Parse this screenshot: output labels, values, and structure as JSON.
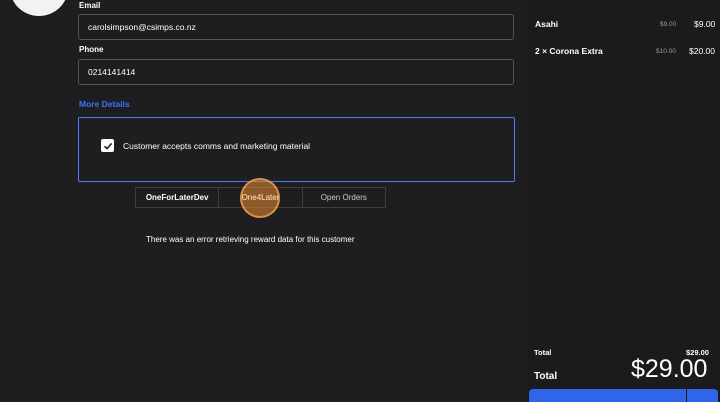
{
  "customer": {
    "email_label": "Email",
    "email_value": "carolsimpson@csimps.co.nz",
    "phone_label": "Phone",
    "phone_value": "0214141414",
    "more_details": "More Details",
    "comms_label": "Customer accepts comms and marketing material",
    "comms_checked": true
  },
  "tabs": [
    "OneForLaterDev",
    "One4Later",
    "Open Orders"
  ],
  "error_message": "There was an error retrieving reward data for this customer",
  "order": {
    "items": [
      {
        "name": "Asahi",
        "unit_price": "$9.00",
        "total": "$9.00"
      },
      {
        "name": "2 × Corona Extra",
        "unit_price": "$10.00",
        "total": "$20.00"
      }
    ],
    "subtotal_label": "Total",
    "subtotal_value": "$29.00",
    "total_label": "Total",
    "total_value": "$29.00"
  },
  "colors": {
    "accent": "#3d73ff",
    "pay_button": "#2f66e8",
    "click_highlight": "#e88c32"
  }
}
